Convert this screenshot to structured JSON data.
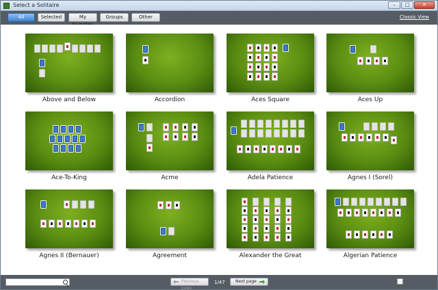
{
  "window": {
    "title": "Select a Solitaire"
  },
  "filters": [
    {
      "label": "All",
      "active": true
    },
    {
      "label": "Selected",
      "active": false
    },
    {
      "label": "My favorites",
      "active": false
    },
    {
      "label": "Groups",
      "active": false
    },
    {
      "label": "Other",
      "active": false
    }
  ],
  "classic_view_label": "Classic View",
  "games": [
    {
      "name": "Above and Below"
    },
    {
      "name": "Accordion"
    },
    {
      "name": "Aces Square"
    },
    {
      "name": "Aces Up"
    },
    {
      "name": "Ace-To-King"
    },
    {
      "name": "Acme"
    },
    {
      "name": "Adela Patience"
    },
    {
      "name": "Agnes I (Sorel)"
    },
    {
      "name": "Agnes II (Bernauer)"
    },
    {
      "name": "Agreement"
    },
    {
      "name": "Alexander the Great"
    },
    {
      "name": "Algerian Patience"
    }
  ],
  "footer": {
    "search_placeholder": "",
    "previous_label": "Previous page",
    "page_indicator": "1/47",
    "next_label": "Next page"
  },
  "colors": {
    "table_green": "#5a8c12",
    "bar_gray": "#555c63",
    "active_tab": "#3d84cf",
    "card_back": "#3f78c8"
  }
}
